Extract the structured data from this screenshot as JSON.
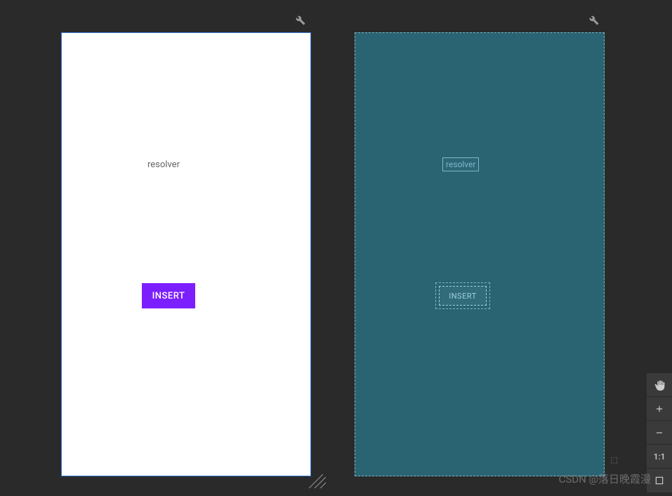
{
  "designPanel": {
    "resolverLabel": "resolver",
    "buttonLabel": "INSERT"
  },
  "blueprintPanel": {
    "resolverLabel": "resolver",
    "buttonLabel": "INSERT"
  },
  "toolbar": {
    "ratio": "1:1"
  },
  "watermark": "CSDN @落日晚霞漫"
}
